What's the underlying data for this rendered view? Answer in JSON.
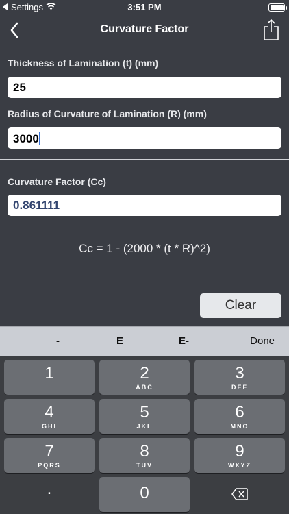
{
  "status": {
    "carrier": "Settings",
    "time": "3:51 PM"
  },
  "nav": {
    "title": "Curvature Factor",
    "back_icon": "chevron-left-icon",
    "share_icon": "share-icon"
  },
  "form": {
    "thickness_label": "Thickness of Lamination (t) (mm)",
    "thickness_value": "25",
    "radius_label": "Radius of Curvature of Lamination (R) (mm)",
    "radius_value": "3000",
    "result_label": "Curvature Factor (Cc)",
    "result_value": "0.861111"
  },
  "formula": "Cc = 1 - (2000 * (t * R)^2)",
  "clear_label": "Clear",
  "accessory": {
    "minus": "-",
    "e": "E",
    "e_minus": "E-",
    "done": "Done"
  },
  "keys": [
    {
      "num": "1",
      "sub": ""
    },
    {
      "num": "2",
      "sub": "ABC"
    },
    {
      "num": "3",
      "sub": "DEF"
    },
    {
      "num": "4",
      "sub": "GHI"
    },
    {
      "num": "5",
      "sub": "JKL"
    },
    {
      "num": "6",
      "sub": "MNO"
    },
    {
      "num": "7",
      "sub": "PQRS"
    },
    {
      "num": "8",
      "sub": "TUV"
    },
    {
      "num": "9",
      "sub": "WXYZ"
    },
    {
      "num": "0",
      "sub": ""
    }
  ],
  "dot_key": ".",
  "colors": {
    "background": "#3a3d44",
    "keyboard": "#3c3e42",
    "key": "#6b6e73",
    "result_text": "#32446f"
  }
}
